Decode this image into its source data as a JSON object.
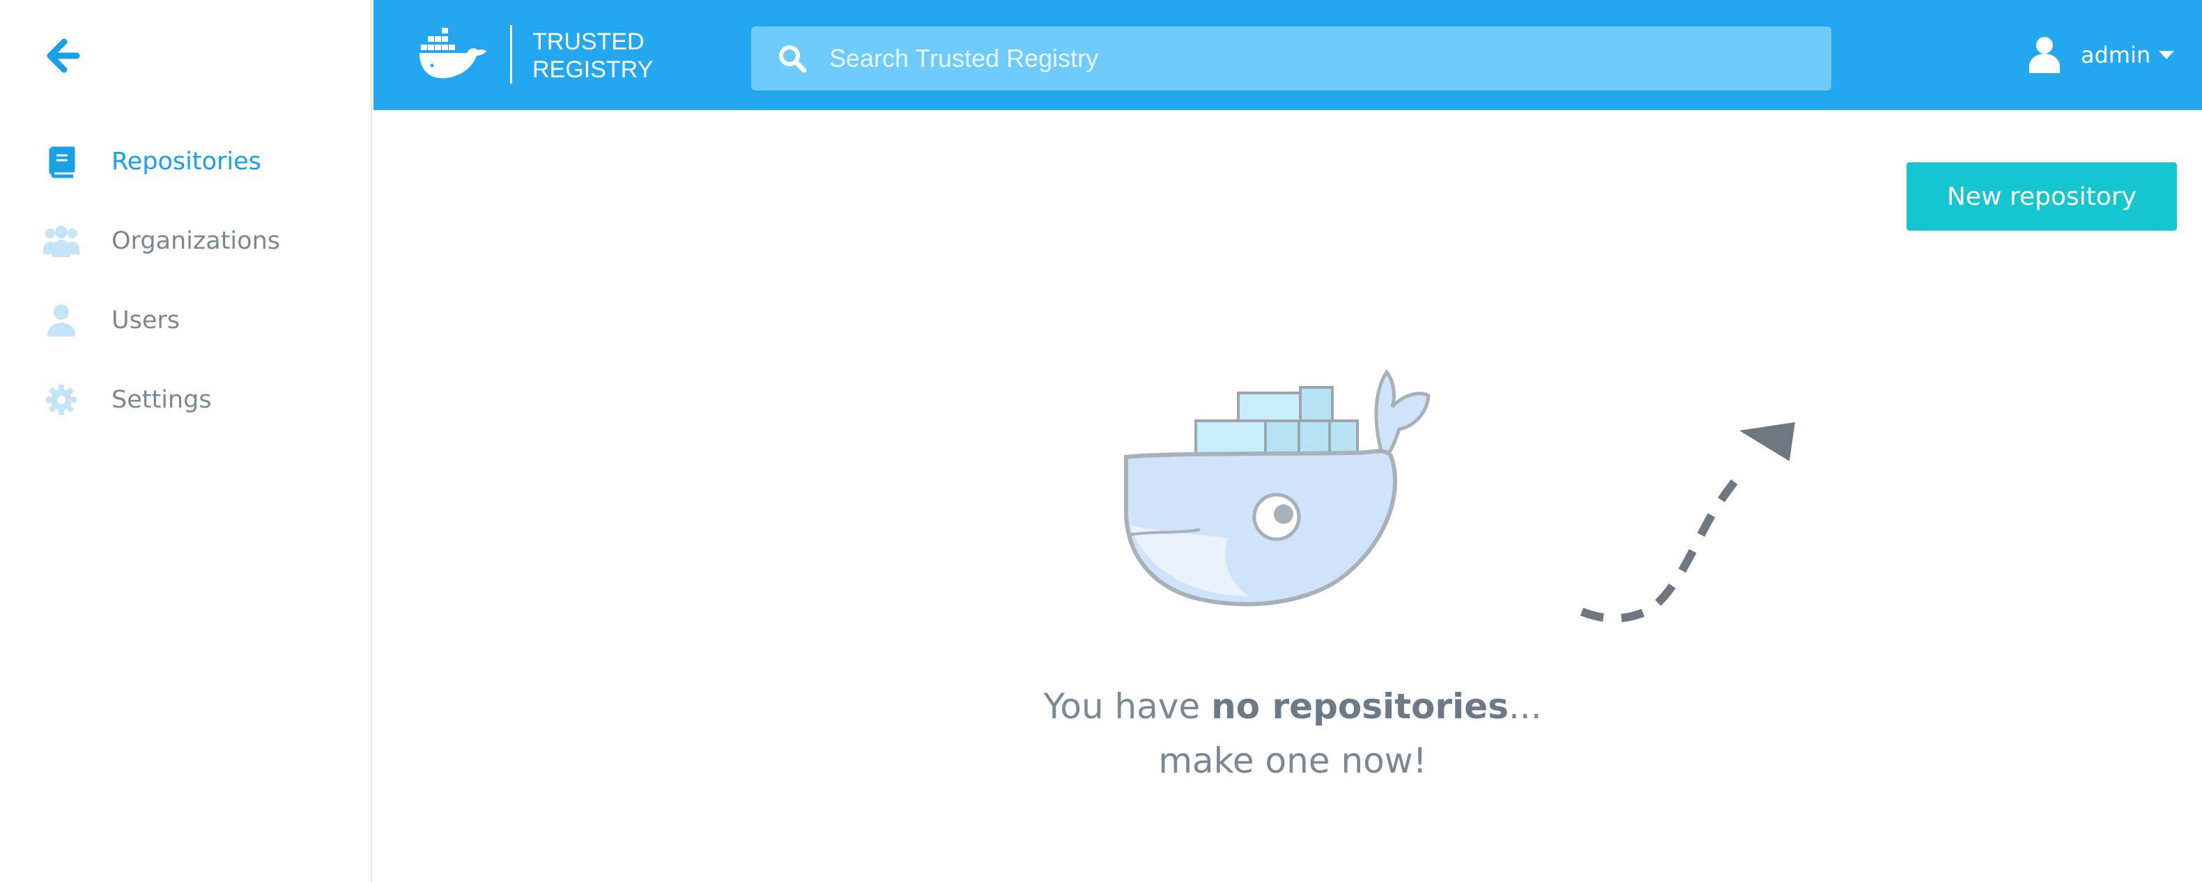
{
  "sidebar": {
    "back_icon": "arrow-left-icon",
    "items": [
      {
        "label": "Repositories",
        "icon": "book-icon",
        "active": true
      },
      {
        "label": "Organizations",
        "icon": "users-group-icon",
        "active": false
      },
      {
        "label": "Users",
        "icon": "user-icon",
        "active": false
      },
      {
        "label": "Settings",
        "icon": "gear-icon",
        "active": false
      }
    ]
  },
  "header": {
    "brand_line1": "TRUSTED",
    "brand_line2": "REGISTRY",
    "search_placeholder": "Search Trusted Registry",
    "search_value": "",
    "user_name": "admin",
    "colors": {
      "header": "#22a7f0",
      "search": "#6ecbfb"
    }
  },
  "main": {
    "new_repo_label": "New repository",
    "empty_prefix": "You have ",
    "empty_bold": "no repositories",
    "empty_suffix": "...",
    "empty_line2": "make one now!",
    "colors": {
      "accent": "#13c6d0",
      "active_nav": "#1aa0e6",
      "muted_text": "#7b8894"
    }
  }
}
